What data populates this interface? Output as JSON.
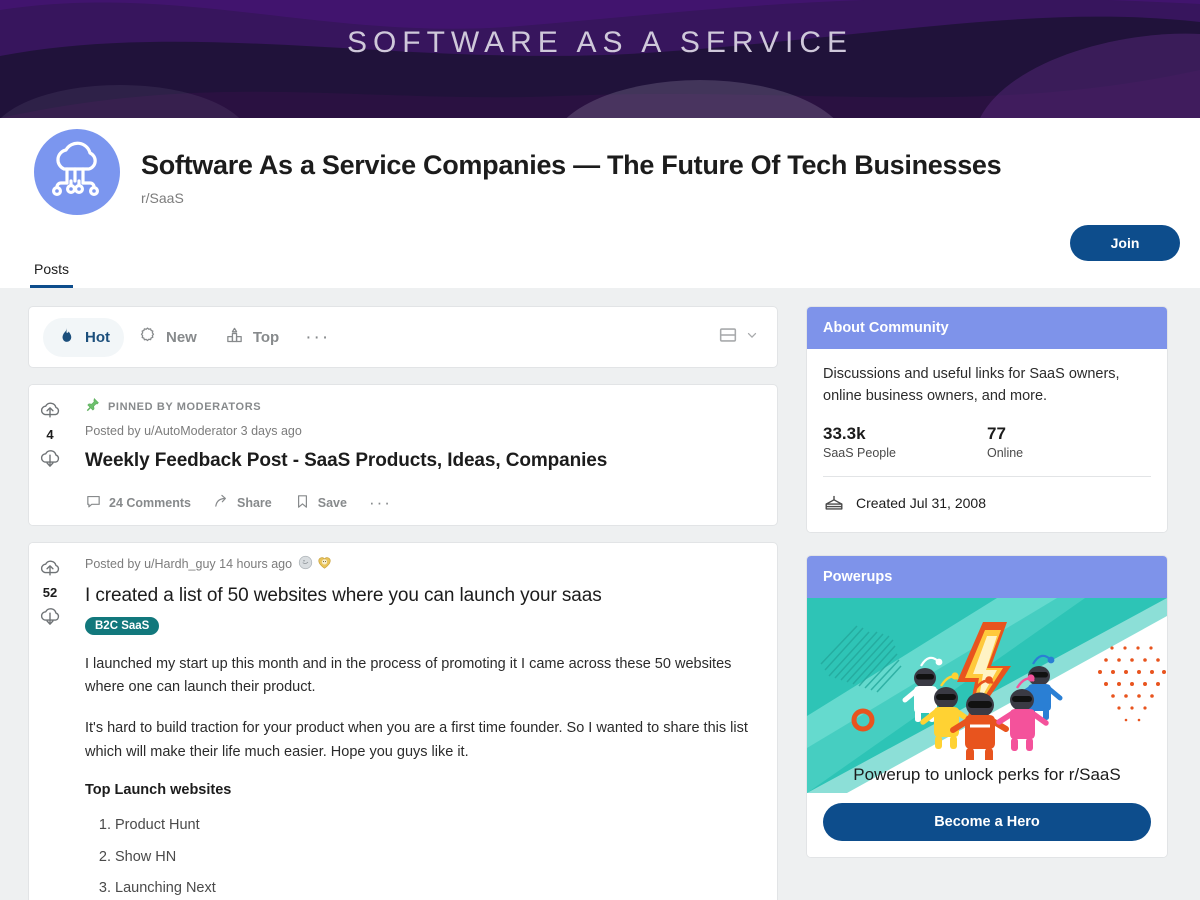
{
  "banner": {
    "title": "SOFTWARE AS A SERVICE"
  },
  "community": {
    "title": "Software As a Service Companies — The Future Of Tech Businesses",
    "subreddit": "r/SaaS",
    "join_label": "Join",
    "avatar_icon": "cloud-network-icon",
    "tabs": [
      {
        "label": "Posts",
        "active": true
      }
    ]
  },
  "sortbar": {
    "options": [
      {
        "label": "Hot",
        "icon": "flame-icon",
        "active": true
      },
      {
        "label": "New",
        "icon": "starburst-icon",
        "active": false
      },
      {
        "label": "Top",
        "icon": "podium-icon",
        "active": false
      }
    ],
    "more_label": "···",
    "view_icon": "card-view-icon",
    "chevron_icon": "chevron-down-icon"
  },
  "posts": [
    {
      "pinned_label": "PINNED BY MODERATORS",
      "pin_icon": "pushpin-icon",
      "score": "4",
      "meta": "Posted by u/AutoModerator 3 days ago",
      "title": "Weekly Feedback Post - SaaS Products, Ideas, Companies",
      "actions": {
        "comments": "24 Comments",
        "share": "Share",
        "save": "Save",
        "more": "···"
      }
    },
    {
      "score": "52",
      "meta": "Posted by u/Hardh_guy 14 hours ago",
      "awards": [
        "silver-award-icon",
        "gold-heart-award-icon"
      ],
      "title": "I created a list of 50 websites where you can launch your saas",
      "flair": "B2C SaaS",
      "paragraphs": [
        "I launched my start up this month and in the process of promoting it I came across these 50 websites where one can launch their product.",
        "It's hard to build traction for your product when you are a first time founder. So I wanted to share this list which will make their life much easier. Hope you guys like it."
      ],
      "list_heading": "Top Launch websites",
      "list_items": [
        "Product Hunt",
        "Show HN",
        "Launching Next"
      ]
    }
  ],
  "sidebar": {
    "about": {
      "header": "About Community",
      "description": "Discussions and useful links for SaaS owners, online business owners, and more.",
      "stats": [
        {
          "value": "33.3k",
          "label": "SaaS People"
        },
        {
          "value": "77",
          "label": "Online"
        }
      ],
      "created": "Created Jul 31, 2008",
      "created_icon": "cake-icon"
    },
    "powerups": {
      "header": "Powerups",
      "caption": "Powerup to unlock perks for r/SaaS",
      "button_label": "Become a Hero"
    }
  },
  "colors": {
    "accent_blue": "#0d4d8c",
    "periwinkle": "#7e93ea",
    "flair_teal": "#12787c",
    "teal_art": "#2ec4b6",
    "page_bg": "#eef0f1"
  }
}
